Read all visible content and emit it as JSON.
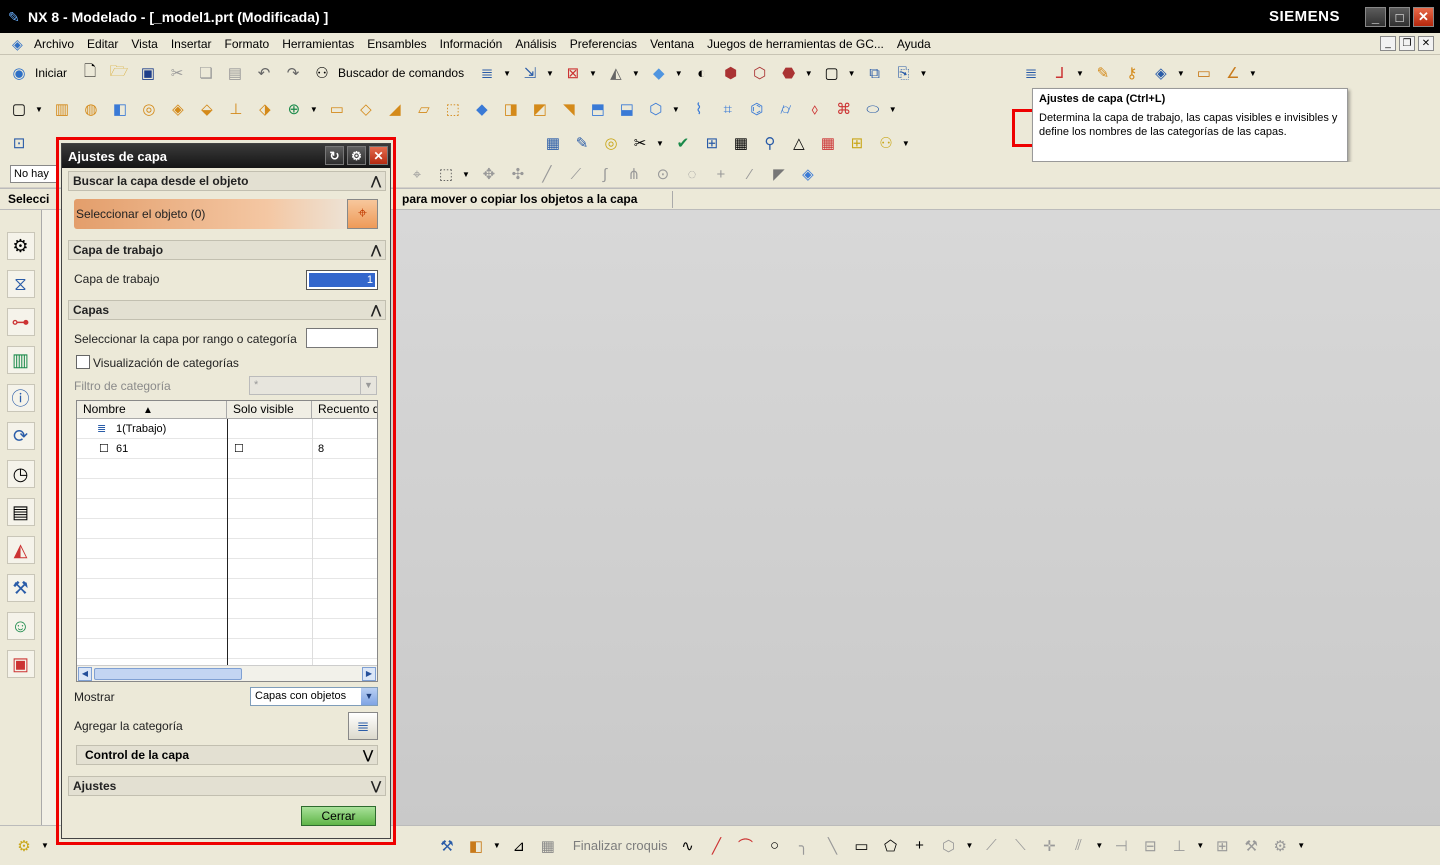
{
  "window": {
    "title": "NX 8 - Modelado - [_model1.prt (Modificada) ]",
    "brand": "SIEMENS",
    "controls": [
      "_",
      "□",
      "✕"
    ]
  },
  "menubar": {
    "items": [
      "Archivo",
      "Editar",
      "Vista",
      "Insertar",
      "Formato",
      "Herramientas",
      "Ensambles",
      "Información",
      "Análisis",
      "Preferencias",
      "Ventana",
      "Juegos de herramientas de GC...",
      "Ayuda"
    ]
  },
  "toolbar": {
    "start_label": "Iniciar",
    "command_finder_label": "Buscador de comandos"
  },
  "tooltip": {
    "title": "Ajustes de capa (Ctrl+L)",
    "body": "Determina la capa de trabajo, las capas visibles e invisibles y define los nombres de las categorías de las capas."
  },
  "filter_combo": {
    "value": "No hay"
  },
  "status": {
    "left": "Selecci",
    "prompt": "para mover o copiar los objetos a la capa"
  },
  "bottom_bar": {
    "finish_sketch_label": "Finalizar croquis"
  },
  "dialog": {
    "title": "Ajustes de capa",
    "section_find": "Buscar la capa desde el objeto",
    "select_object_label": "Seleccionar el objeto (0)",
    "section_work_layer": "Capa de trabajo",
    "work_layer_label": "Capa de trabajo",
    "work_layer_value": "1",
    "section_layers": "Capas",
    "select_range_label": "Seleccionar la capa por rango o categoría",
    "select_range_value": "",
    "category_display_label": "Visualización de categorías",
    "category_filter_label": "Filtro de categoría",
    "category_filter_value": "*",
    "columns": [
      "Nombre",
      "Solo visible",
      "Recuento d"
    ],
    "rows": [
      {
        "name": "1(Trabajo)",
        "visible_only": "",
        "count": ""
      },
      {
        "name": "61",
        "visible_only": "☐",
        "count": "8"
      }
    ],
    "show_label": "Mostrar",
    "show_value": "Capas con objetos",
    "add_category_label": "Agregar la categoría",
    "layer_control_label": "Control de la capa",
    "section_settings": "Ajustes",
    "close_button": "Cerrar"
  },
  "colors": {
    "title_bg": "#000000",
    "highlight": "#e00000",
    "graphics_bg": "#d0d0d0",
    "close_button": "#6cbd55"
  }
}
